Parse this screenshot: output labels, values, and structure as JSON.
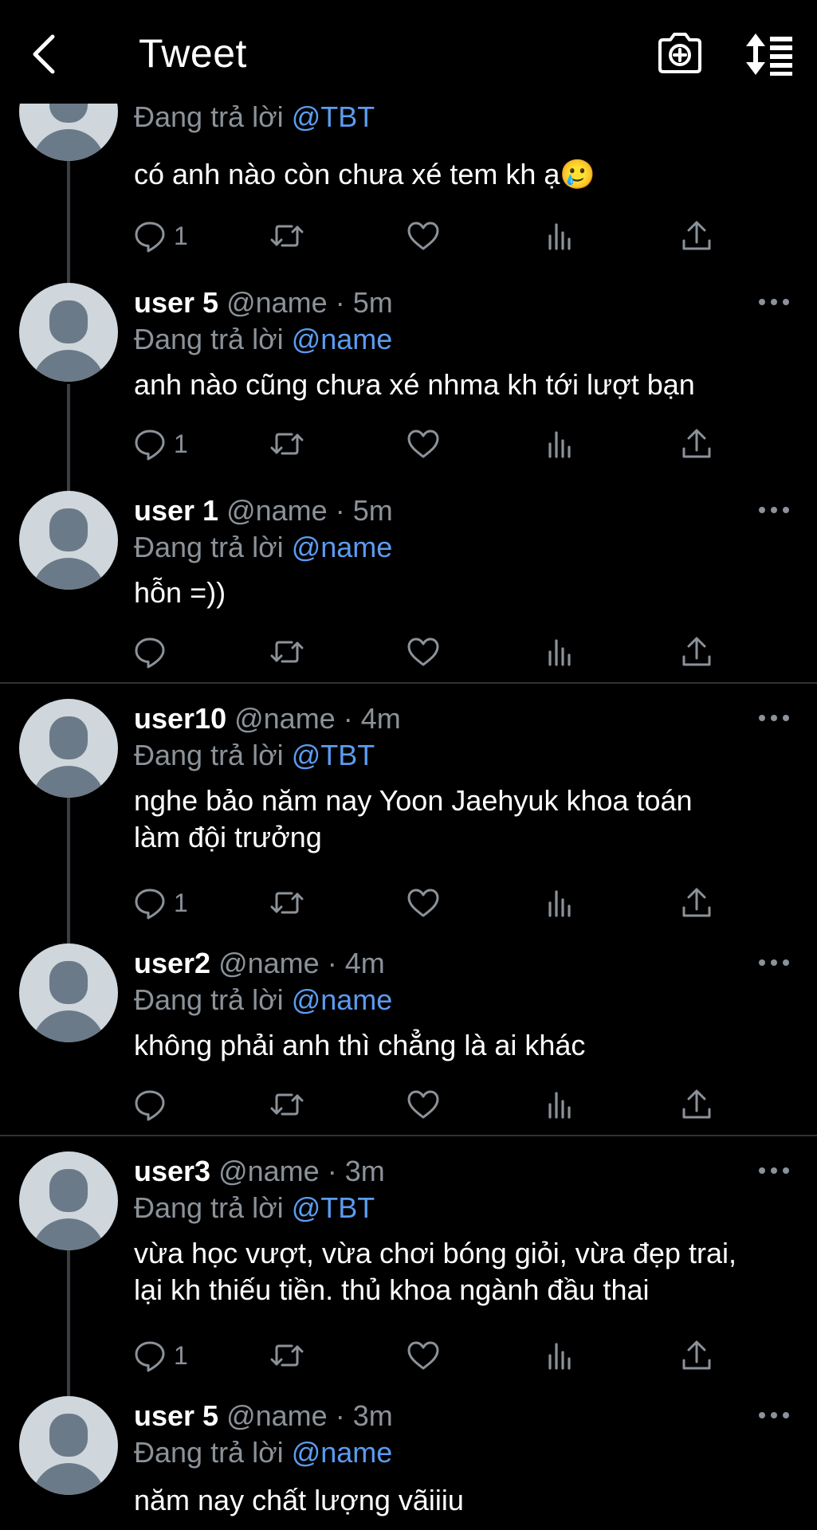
{
  "header": {
    "title": "Tweet",
    "back_icon": "chevron-left-icon",
    "camera_icon": "camera-plus-icon",
    "sort_icon": "sort-list-icon"
  },
  "colors": {
    "background": "#000000",
    "text": "#ffffff",
    "secondary": "#8b9299",
    "mention": "#5b9cf0",
    "thread_line": "#3a3f45",
    "avatar_bg": "#cfd6dc",
    "avatar_fg": "#6b7a88"
  },
  "tweets": [
    {
      "replying_label": "Đang trả lời",
      "replying_to": "@TBT",
      "text": "có anh nào còn chưa xé tem kh ạ🥲",
      "reply_count": "1"
    },
    {
      "username": "user 5",
      "handle": "@name",
      "time": "· 5m",
      "replying_label": "Đang trả lời",
      "replying_to": "@name",
      "text": "anh nào cũng chưa xé nhma kh tới lượt bạn",
      "reply_count": "1"
    },
    {
      "username": "user 1",
      "handle": "@name",
      "time": "· 5m",
      "replying_label": "Đang trả lời",
      "replying_to": "@name",
      "text": "hỗn =))",
      "reply_count": ""
    },
    {
      "username": "user10",
      "handle": "@name",
      "time": "· 4m",
      "replying_label": "Đang trả lời",
      "replying_to": "@TBT",
      "text_line1": "nghe bảo năm nay Yoon Jaehyuk khoa toán",
      "text_line2": "làm đội trưởng",
      "reply_count": "1"
    },
    {
      "username": "user2",
      "handle": "@name",
      "time": "· 4m",
      "replying_label": "Đang trả lời",
      "replying_to": "@name",
      "text": "không phải anh thì chẳng là ai khác",
      "reply_count": ""
    },
    {
      "username": "user3",
      "handle": "@name",
      "time": "· 3m",
      "replying_label": "Đang trả lời",
      "replying_to": "@TBT",
      "text_line1": "vừa học vượt, vừa chơi bóng giỏi, vừa đẹp trai,",
      "text_line2": "lại kh thiếu tiền. thủ khoa ngành đầu thai",
      "reply_count": "1"
    },
    {
      "username": "user 5",
      "handle": "@name",
      "time": "· 3m",
      "replying_label": "Đang trả lời",
      "replying_to": "@name",
      "text": "năm nay chất lượng vãiiiu"
    }
  ]
}
